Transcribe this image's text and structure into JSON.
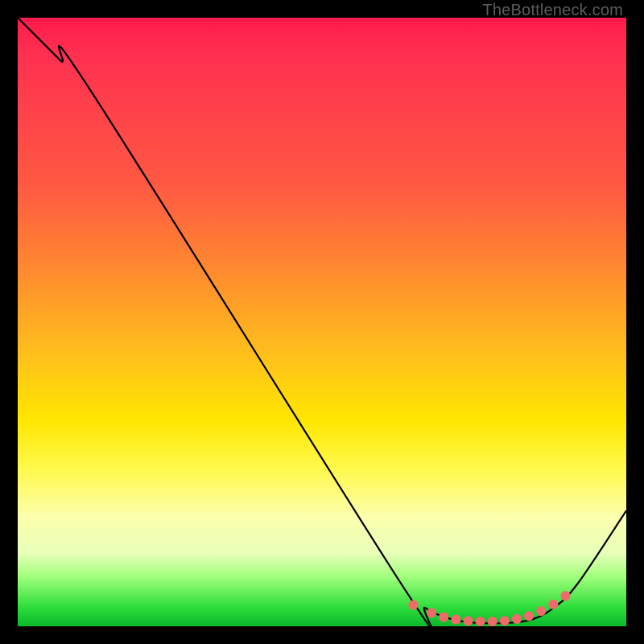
{
  "watermark": "TheBottleneck.com",
  "chart_data": {
    "type": "line",
    "title": "",
    "xlabel": "",
    "ylabel": "",
    "xlim": [
      0,
      100
    ],
    "ylim": [
      0,
      100
    ],
    "grid": false,
    "legend": false,
    "series": [
      {
        "name": "bottleneck-curve",
        "color": "#000000",
        "points": [
          {
            "x": 0,
            "y": 100
          },
          {
            "x": 7,
            "y": 93
          },
          {
            "x": 12,
            "y": 88
          },
          {
            "x": 63,
            "y": 7
          },
          {
            "x": 67,
            "y": 3
          },
          {
            "x": 72,
            "y": 1
          },
          {
            "x": 78,
            "y": 0.5
          },
          {
            "x": 84,
            "y": 1
          },
          {
            "x": 88,
            "y": 3
          },
          {
            "x": 92,
            "y": 7
          },
          {
            "x": 100,
            "y": 19
          }
        ]
      }
    ],
    "markers": [
      {
        "name": "dot-cluster",
        "color": "#f06a6a",
        "r": 6,
        "points": [
          {
            "x": 65,
            "y": 3.5
          },
          {
            "x": 68,
            "y": 2.2
          },
          {
            "x": 70,
            "y": 1.5
          },
          {
            "x": 72,
            "y": 1.1
          },
          {
            "x": 74,
            "y": 0.9
          },
          {
            "x": 76,
            "y": 0.8
          },
          {
            "x": 78,
            "y": 0.8
          },
          {
            "x": 80,
            "y": 0.9
          },
          {
            "x": 82,
            "y": 1.2
          },
          {
            "x": 84,
            "y": 1.7
          },
          {
            "x": 86,
            "y": 2.5
          },
          {
            "x": 88,
            "y": 3.6
          },
          {
            "x": 90,
            "y": 5.0
          }
        ]
      }
    ]
  }
}
